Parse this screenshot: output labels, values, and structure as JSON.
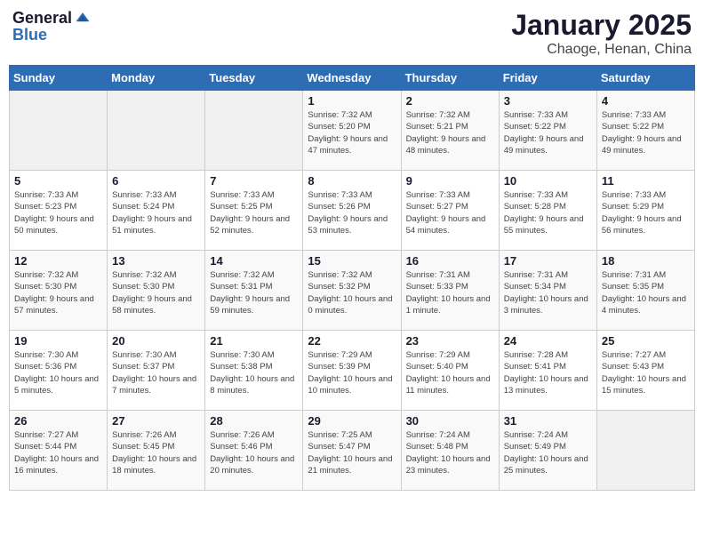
{
  "header": {
    "logo_line1": "General",
    "logo_line2": "Blue",
    "title": "January 2025",
    "subtitle": "Chaoge, Henan, China"
  },
  "weekdays": [
    "Sunday",
    "Monday",
    "Tuesday",
    "Wednesday",
    "Thursday",
    "Friday",
    "Saturday"
  ],
  "weeks": [
    [
      {
        "day": "",
        "detail": ""
      },
      {
        "day": "",
        "detail": ""
      },
      {
        "day": "",
        "detail": ""
      },
      {
        "day": "1",
        "detail": "Sunrise: 7:32 AM\nSunset: 5:20 PM\nDaylight: 9 hours and 47 minutes."
      },
      {
        "day": "2",
        "detail": "Sunrise: 7:32 AM\nSunset: 5:21 PM\nDaylight: 9 hours and 48 minutes."
      },
      {
        "day": "3",
        "detail": "Sunrise: 7:33 AM\nSunset: 5:22 PM\nDaylight: 9 hours and 49 minutes."
      },
      {
        "day": "4",
        "detail": "Sunrise: 7:33 AM\nSunset: 5:22 PM\nDaylight: 9 hours and 49 minutes."
      }
    ],
    [
      {
        "day": "5",
        "detail": "Sunrise: 7:33 AM\nSunset: 5:23 PM\nDaylight: 9 hours and 50 minutes."
      },
      {
        "day": "6",
        "detail": "Sunrise: 7:33 AM\nSunset: 5:24 PM\nDaylight: 9 hours and 51 minutes."
      },
      {
        "day": "7",
        "detail": "Sunrise: 7:33 AM\nSunset: 5:25 PM\nDaylight: 9 hours and 52 minutes."
      },
      {
        "day": "8",
        "detail": "Sunrise: 7:33 AM\nSunset: 5:26 PM\nDaylight: 9 hours and 53 minutes."
      },
      {
        "day": "9",
        "detail": "Sunrise: 7:33 AM\nSunset: 5:27 PM\nDaylight: 9 hours and 54 minutes."
      },
      {
        "day": "10",
        "detail": "Sunrise: 7:33 AM\nSunset: 5:28 PM\nDaylight: 9 hours and 55 minutes."
      },
      {
        "day": "11",
        "detail": "Sunrise: 7:33 AM\nSunset: 5:29 PM\nDaylight: 9 hours and 56 minutes."
      }
    ],
    [
      {
        "day": "12",
        "detail": "Sunrise: 7:32 AM\nSunset: 5:30 PM\nDaylight: 9 hours and 57 minutes."
      },
      {
        "day": "13",
        "detail": "Sunrise: 7:32 AM\nSunset: 5:30 PM\nDaylight: 9 hours and 58 minutes."
      },
      {
        "day": "14",
        "detail": "Sunrise: 7:32 AM\nSunset: 5:31 PM\nDaylight: 9 hours and 59 minutes."
      },
      {
        "day": "15",
        "detail": "Sunrise: 7:32 AM\nSunset: 5:32 PM\nDaylight: 10 hours and 0 minutes."
      },
      {
        "day": "16",
        "detail": "Sunrise: 7:31 AM\nSunset: 5:33 PM\nDaylight: 10 hours and 1 minute."
      },
      {
        "day": "17",
        "detail": "Sunrise: 7:31 AM\nSunset: 5:34 PM\nDaylight: 10 hours and 3 minutes."
      },
      {
        "day": "18",
        "detail": "Sunrise: 7:31 AM\nSunset: 5:35 PM\nDaylight: 10 hours and 4 minutes."
      }
    ],
    [
      {
        "day": "19",
        "detail": "Sunrise: 7:30 AM\nSunset: 5:36 PM\nDaylight: 10 hours and 5 minutes."
      },
      {
        "day": "20",
        "detail": "Sunrise: 7:30 AM\nSunset: 5:37 PM\nDaylight: 10 hours and 7 minutes."
      },
      {
        "day": "21",
        "detail": "Sunrise: 7:30 AM\nSunset: 5:38 PM\nDaylight: 10 hours and 8 minutes."
      },
      {
        "day": "22",
        "detail": "Sunrise: 7:29 AM\nSunset: 5:39 PM\nDaylight: 10 hours and 10 minutes."
      },
      {
        "day": "23",
        "detail": "Sunrise: 7:29 AM\nSunset: 5:40 PM\nDaylight: 10 hours and 11 minutes."
      },
      {
        "day": "24",
        "detail": "Sunrise: 7:28 AM\nSunset: 5:41 PM\nDaylight: 10 hours and 13 minutes."
      },
      {
        "day": "25",
        "detail": "Sunrise: 7:27 AM\nSunset: 5:43 PM\nDaylight: 10 hours and 15 minutes."
      }
    ],
    [
      {
        "day": "26",
        "detail": "Sunrise: 7:27 AM\nSunset: 5:44 PM\nDaylight: 10 hours and 16 minutes."
      },
      {
        "day": "27",
        "detail": "Sunrise: 7:26 AM\nSunset: 5:45 PM\nDaylight: 10 hours and 18 minutes."
      },
      {
        "day": "28",
        "detail": "Sunrise: 7:26 AM\nSunset: 5:46 PM\nDaylight: 10 hours and 20 minutes."
      },
      {
        "day": "29",
        "detail": "Sunrise: 7:25 AM\nSunset: 5:47 PM\nDaylight: 10 hours and 21 minutes."
      },
      {
        "day": "30",
        "detail": "Sunrise: 7:24 AM\nSunset: 5:48 PM\nDaylight: 10 hours and 23 minutes."
      },
      {
        "day": "31",
        "detail": "Sunrise: 7:24 AM\nSunset: 5:49 PM\nDaylight: 10 hours and 25 minutes."
      },
      {
        "day": "",
        "detail": ""
      }
    ]
  ]
}
